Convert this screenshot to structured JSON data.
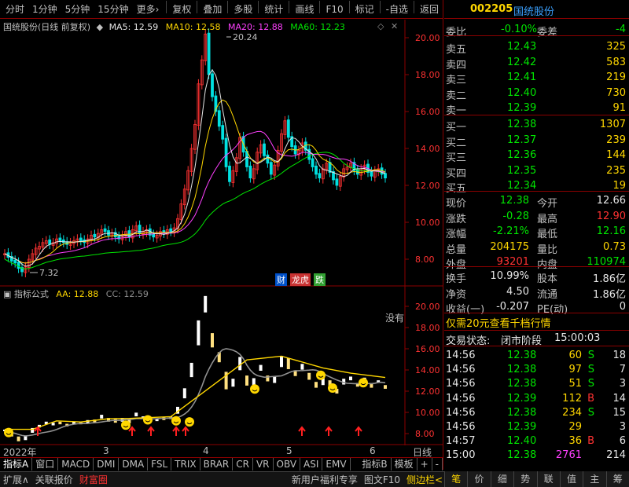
{
  "toolbar": {
    "left": [
      "分时",
      "1分钟",
      "5分钟",
      "15分钟",
      "更多›"
    ],
    "right": [
      "复权",
      "叠加",
      "多股",
      "统计",
      "画线",
      "F10",
      "标记",
      "-自选",
      "返回"
    ]
  },
  "stock": {
    "code": "002205",
    "name": "国统股份"
  },
  "main": {
    "title": "国统股份(日线 前复权)",
    "ma5": "MA5: 12.59",
    "ma10": "MA10: 12.58",
    "ma20": "MA20: 12.88",
    "ma60": "MA60: 12.23",
    "peak": "20.24",
    "low": "7.32",
    "badges": [
      "财",
      "龙虎",
      "跌"
    ],
    "yticks": [
      "20.00",
      "18.00",
      "16.00",
      "14.00",
      "12.00",
      "10.00",
      "8.00"
    ]
  },
  "indicator": {
    "title": "指标公式",
    "aa": "AA: 12.88",
    "cc": "CC: 12.59",
    "note": "没有",
    "yticks": [
      "20.00",
      "18.00",
      "16.00",
      "14.00",
      "12.00",
      "10.00",
      "8.00"
    ]
  },
  "xaxis": {
    "labels": [
      "2022年",
      "3",
      "4",
      "5",
      "6"
    ],
    "period": "日线"
  },
  "tabs": [
    "指标A",
    "窗口",
    "MACD",
    "DMI",
    "DMA",
    "FSL",
    "TRIX",
    "BRAR",
    "CR",
    "VR",
    "OBV",
    "ASI",
    "EMV",
    "",
    "指标B",
    "模板",
    "+",
    "-"
  ],
  "quote": {
    "webi": {
      "label": "委比",
      "value": "-0.10%",
      "diff_label": "委差",
      "diff": "-4"
    },
    "asks": [
      {
        "l": "卖五",
        "p": "12.43",
        "v": "325"
      },
      {
        "l": "卖四",
        "p": "12.42",
        "v": "583"
      },
      {
        "l": "卖三",
        "p": "12.41",
        "v": "219"
      },
      {
        "l": "卖二",
        "p": "12.40",
        "v": "730"
      },
      {
        "l": "卖一",
        "p": "12.39",
        "v": "91"
      }
    ],
    "bids": [
      {
        "l": "买一",
        "p": "12.38",
        "v": "1307"
      },
      {
        "l": "买二",
        "p": "12.37",
        "v": "239"
      },
      {
        "l": "买三",
        "p": "12.36",
        "v": "144"
      },
      {
        "l": "买四",
        "p": "12.35",
        "v": "235"
      },
      {
        "l": "买五",
        "p": "12.34",
        "v": "19"
      }
    ],
    "stats": [
      {
        "l1": "现价",
        "v1": "12.38",
        "c1": "green",
        "l2": "今开",
        "v2": "12.66",
        "c2": "white"
      },
      {
        "l1": "涨跌",
        "v1": "-0.28",
        "c1": "green",
        "l2": "最高",
        "v2": "12.90",
        "c2": "red"
      },
      {
        "l1": "涨幅",
        "v1": "-2.21%",
        "c1": "green",
        "l2": "最低",
        "v2": "12.16",
        "c2": "green"
      },
      {
        "l1": "总量",
        "v1": "204175",
        "c1": "yellow",
        "l2": "量比",
        "v2": "0.73",
        "c2": "yellow"
      },
      {
        "l1": "外盘",
        "v1": "93201",
        "c1": "red",
        "l2": "内盘",
        "v2": "110974",
        "c2": "green"
      }
    ],
    "stats2": [
      {
        "l1": "换手",
        "v1": "10.99%",
        "l2": "股本",
        "v2": "1.86亿"
      },
      {
        "l1": "净资",
        "v1": "4.50",
        "l2": "流通",
        "v2": "1.86亿"
      },
      {
        "l1": "收益(一)",
        "v1": "-0.207",
        "l2": "PE(动)",
        "v2": "0"
      }
    ],
    "promo": "仅需20元查看千档行情",
    "status_label": "交易状态:",
    "status": "闭市阶段",
    "status_time": "15:00:03"
  },
  "ticks": [
    {
      "t": "14:56",
      "p": "12.38",
      "pc": "green",
      "v": "60",
      "d": "S"
    },
    {
      "t": "14:56",
      "p": "12.38",
      "pc": "green",
      "v": "97",
      "d": "S"
    },
    {
      "t": "14:56",
      "p": "12.38",
      "pc": "green",
      "v": "51",
      "d": "S"
    },
    {
      "t": "14:56",
      "p": "12.39",
      "pc": "green",
      "v": "112",
      "d": "B"
    },
    {
      "t": "14:56",
      "p": "12.38",
      "pc": "green",
      "v": "234",
      "d": "S"
    },
    {
      "t": "14:56",
      "p": "12.39",
      "pc": "green",
      "v": "29",
      "d": ""
    },
    {
      "t": "14:57",
      "p": "12.40",
      "pc": "green",
      "v": "36",
      "d": "B"
    },
    {
      "t": "15:00",
      "p": "12.38",
      "pc": "green",
      "v": "2761",
      "d": ""
    }
  ],
  "tick_counts": [
    "18",
    "7",
    "3",
    "14",
    "15",
    "3",
    "6",
    "214"
  ],
  "bottombar": {
    "left": [
      "扩展∧",
      "关联报价",
      "财富圈"
    ],
    "right": [
      "新用户福利专享",
      "图文F10",
      "侧边栏<"
    ]
  },
  "rightstrip": [
    "笔",
    "价",
    "细",
    "势",
    "联",
    "值",
    "主",
    "筹"
  ]
}
